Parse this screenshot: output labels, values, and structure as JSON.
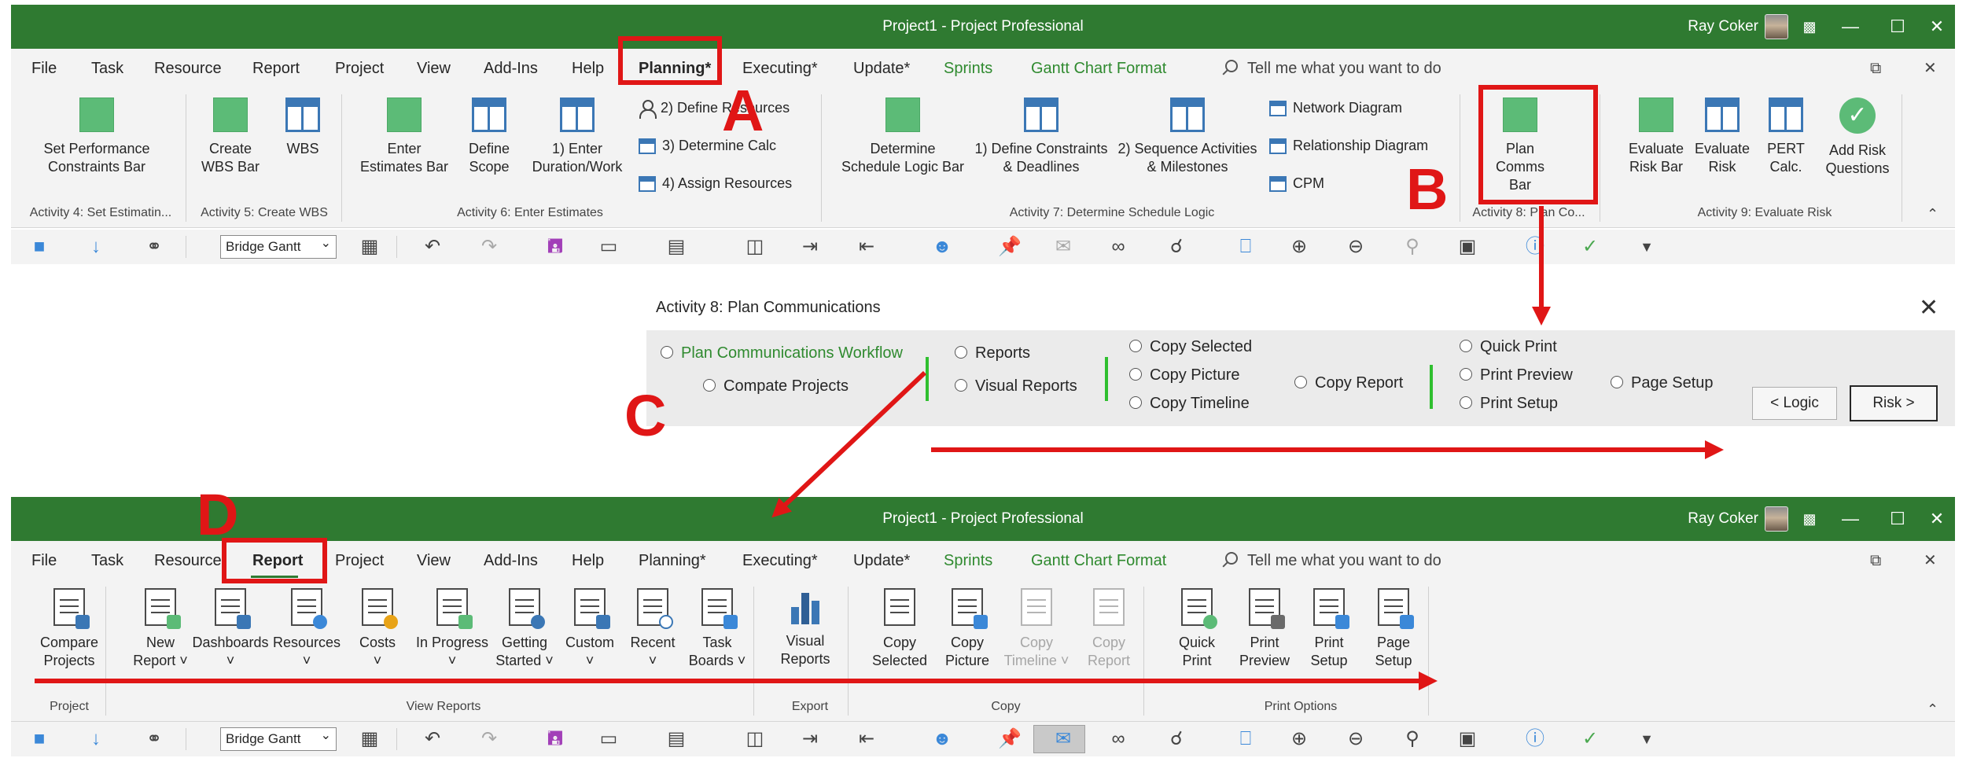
{
  "window": {
    "title": "Project1  -  Project Professional",
    "user": "Ray Coker",
    "minimize_glyph": "—",
    "restore_glyph": "☐",
    "close_glyph": "✕"
  },
  "menu_top": {
    "tabs": [
      "File",
      "Task",
      "Resource",
      "Report",
      "Project",
      "View",
      "Add-Ins",
      "Help",
      "Planning*",
      "Executing*",
      "Update*",
      "Sprints",
      "Gantt Chart Format"
    ],
    "search_placeholder": "Tell me what you want to do"
  },
  "ribbon_top": {
    "buttons": {
      "set_perf": "Set Performance\nConstraints Bar",
      "create_wbs": "Create\nWBS Bar",
      "wbs": "WBS",
      "enter_est": "Enter\nEstimates Bar",
      "define_scope": "Define\nScope",
      "enter_duration": "1) Enter\nDuration/Work",
      "define_res": "2) Define Resources",
      "determine_calc": "3) Determine Calc",
      "assign_res": "4) Assign Resources",
      "det_sched": "Determine\nSchedule Logic Bar",
      "def_constraints": "1) Define Constraints\n& Deadlines",
      "seq_activities": "2) Sequence Activities\n& Milestones",
      "network_diagram": "Network Diagram",
      "relationship_diagram": "Relationship Diagram",
      "cpm": "CPM",
      "plan_comms": "Plan\nComms Bar",
      "eval_risk_bar": "Evaluate\nRisk Bar",
      "eval_risk": "Evaluate\nRisk",
      "pert": "PERT\nCalc.",
      "add_risk": "Add Risk\nQuestions"
    },
    "groups": {
      "g4": "Activity 4: Set Estimatin...",
      "g5": "Activity 5: Create WBS",
      "g6": "Activity 6: Enter Estimates",
      "g7": "Activity 7: Determine Schedule Logic",
      "g8": "Activity 8: Plan Co...",
      "g9": "Activity 9: Evaluate Risk"
    }
  },
  "qat": {
    "view_select": "Bridge Gantt"
  },
  "dialog": {
    "title": "Activity 8: Plan Communications",
    "options": {
      "workflow": "Plan Communications Workflow",
      "compare": "Compate Projects",
      "reports": "Reports",
      "visual_reports": "Visual Reports",
      "copy_selected": "Copy Selected",
      "copy_picture": "Copy Picture",
      "copy_timeline": "Copy Timeline",
      "copy_report": "Copy Report",
      "quick_print": "Quick Print",
      "print_preview": "Print Preview",
      "print_setup": "Print Setup",
      "page_setup": "Page Setup"
    },
    "logic_button": "< Logic",
    "risk_button": "Risk >"
  },
  "ribbon_bottom": {
    "buttons": {
      "compare": "Compare\nProjects",
      "new_report": "New\nReport ˅",
      "dashboards": "Dashboards\n˅",
      "resources": "Resources\n˅",
      "costs": "Costs\n˅",
      "in_progress": "In Progress\n˅",
      "getting_started": "Getting\nStarted ˅",
      "custom": "Custom\n˅",
      "recent": "Recent\n˅",
      "task_boards": "Task\nBoards ˅",
      "visual_reports": "Visual\nReports",
      "copy_selected": "Copy\nSelected",
      "copy_picture": "Copy\nPicture",
      "copy_timeline": "Copy\nTimeline ˅",
      "copy_report": "Copy\nReport",
      "quick_print": "Quick\nPrint",
      "print_preview": "Print\nPreview",
      "print_setup": "Print\nSetup",
      "page_setup": "Page\nSetup"
    },
    "groups": {
      "project": "Project",
      "view_reports": "View Reports",
      "export": "Export",
      "copy": "Copy",
      "print_options": "Print Options"
    }
  },
  "annotations": {
    "a": "A",
    "b": "B",
    "c": "C",
    "d": "D",
    "color": "#e01616"
  },
  "colors": {
    "titlebar": "#2f7a31",
    "ribbon_bg": "#f3f3f3",
    "accent_blue": "#3b77b5",
    "accent_green": "#5cbb77"
  }
}
